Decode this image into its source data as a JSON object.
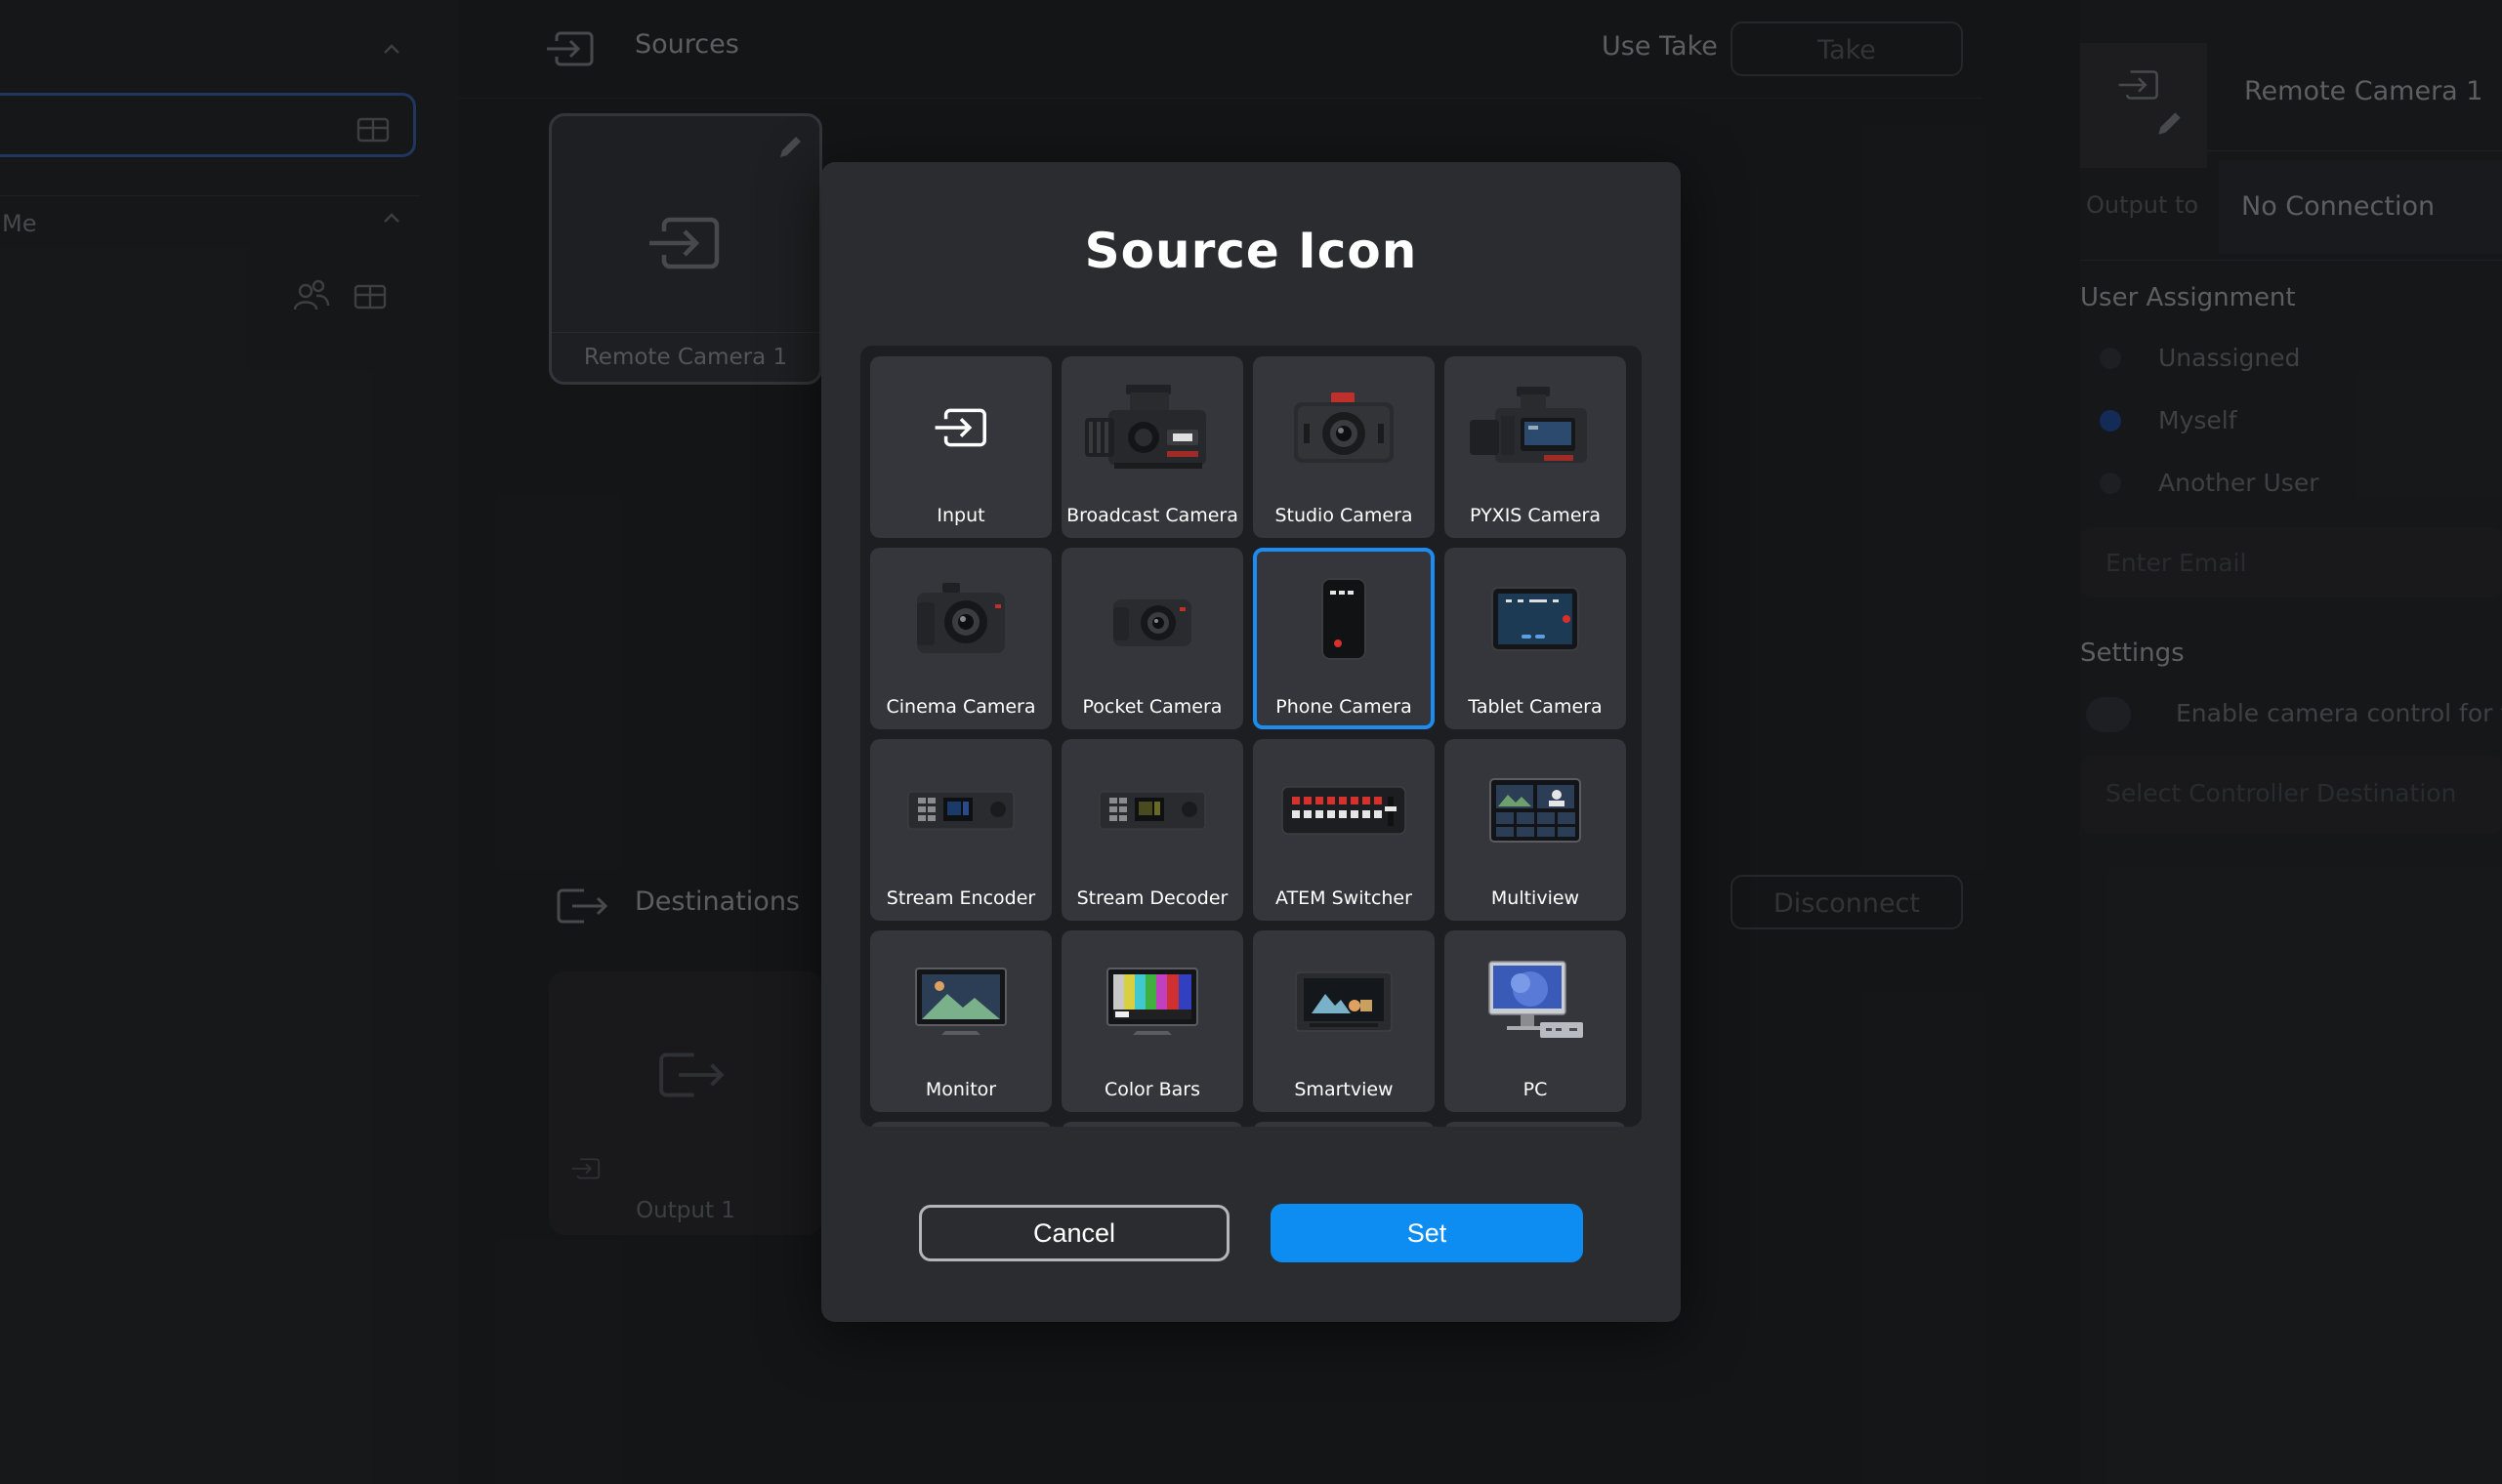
{
  "background": {
    "left_panel": {
      "section_label": "Me"
    },
    "sources": {
      "title": "Sources",
      "use_take_label": "Use Take",
      "take_button": "Take",
      "card_name": "Remote Camera 1"
    },
    "destinations": {
      "title": "Destinations",
      "disconnect_button": "Disconnect",
      "card_name": "Output 1"
    },
    "right_panel": {
      "title": "Remote Camera 1",
      "output_to_label": "Output to",
      "output_to_value": "No Connection",
      "user_assignment_title": "User Assignment",
      "options": [
        "Unassigned",
        "Myself",
        "Another User"
      ],
      "selected_option": "Myself",
      "email_placeholder": "Enter Email",
      "settings_title": "Settings",
      "camera_control_label": "Enable camera control for thi",
      "controller_placeholder": "Select Controller Destination"
    }
  },
  "modal": {
    "title": "Source Icon",
    "icons": [
      {
        "label": "Input",
        "icon": "input-icon"
      },
      {
        "label": "Broadcast Camera",
        "icon": "broadcast-camera-icon"
      },
      {
        "label": "Studio Camera",
        "icon": "studio-camera-icon"
      },
      {
        "label": "PYXIS Camera",
        "icon": "pyxis-camera-icon"
      },
      {
        "label": "Cinema Camera",
        "icon": "cinema-camera-icon"
      },
      {
        "label": "Pocket Camera",
        "icon": "pocket-camera-icon"
      },
      {
        "label": "Phone Camera",
        "icon": "phone-camera-icon"
      },
      {
        "label": "Tablet Camera",
        "icon": "tablet-camera-icon"
      },
      {
        "label": "Stream Encoder",
        "icon": "stream-encoder-icon"
      },
      {
        "label": "Stream Decoder",
        "icon": "stream-decoder-icon"
      },
      {
        "label": "ATEM Switcher",
        "icon": "atem-switcher-icon"
      },
      {
        "label": "Multiview",
        "icon": "multiview-icon"
      },
      {
        "label": "Monitor",
        "icon": "monitor-icon"
      },
      {
        "label": "Color Bars",
        "icon": "color-bars-icon"
      },
      {
        "label": "Smartview",
        "icon": "smartview-icon"
      },
      {
        "label": "PC",
        "icon": "pc-icon"
      }
    ],
    "selected": "Phone Camera",
    "cancel_label": "Cancel",
    "set_label": "Set",
    "accent_color": "#0d8cf2",
    "selection_color": "#1c8cf0"
  }
}
